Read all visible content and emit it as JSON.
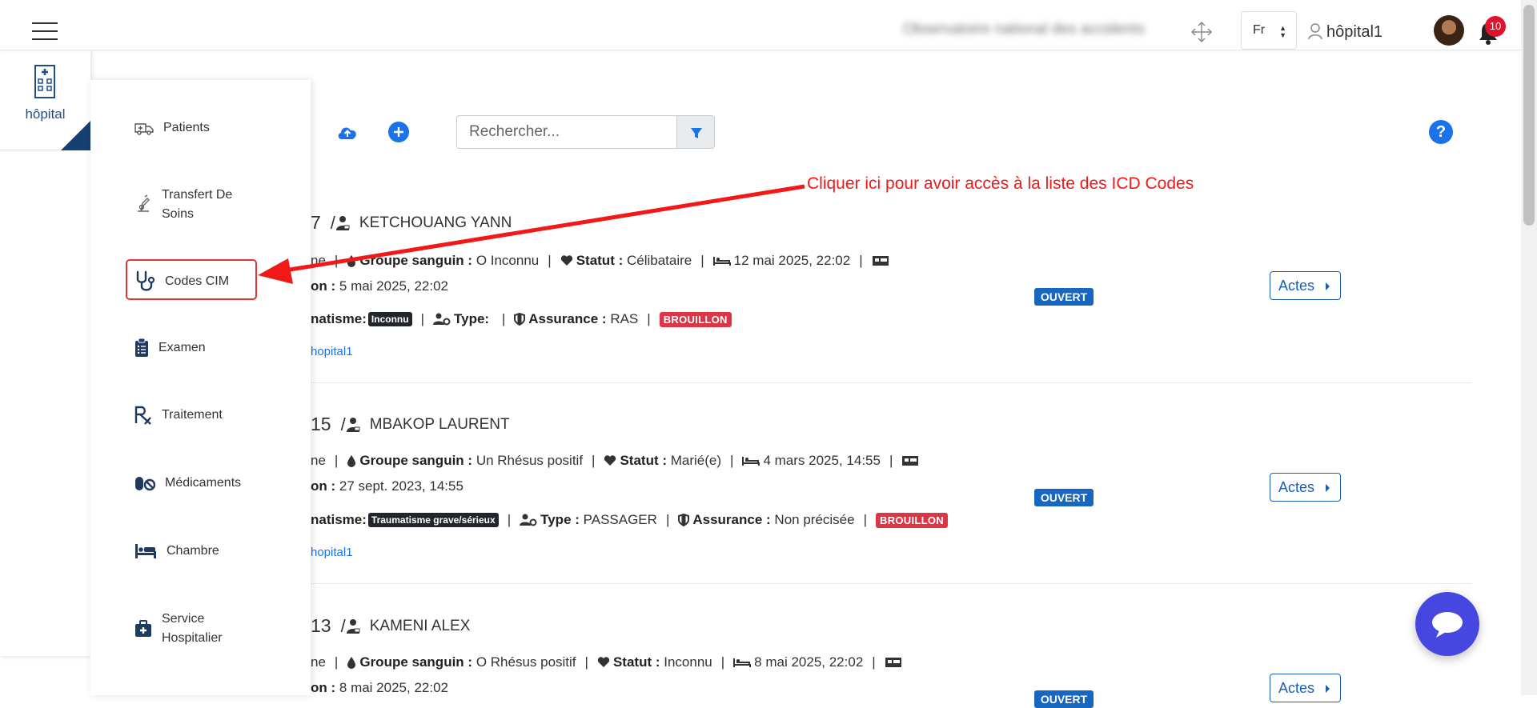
{
  "topbar": {
    "blurred_title": "Observatoire national des accidents",
    "language": "Fr",
    "username": "hôpital1",
    "notification_count": "10"
  },
  "left_panel": {
    "hospital_label": "hôpital"
  },
  "menu": {
    "items": [
      {
        "label": "Patients",
        "icon": "ambulance-icon"
      },
      {
        "label": "Transfert De Soins",
        "icon": "transfer-icon"
      },
      {
        "label": "Codes CIM",
        "icon": "stethoscope-icon"
      },
      {
        "label": "Examen",
        "icon": "clipboard-list-icon"
      },
      {
        "label": "Traitement",
        "icon": "prescription-icon"
      },
      {
        "label": "Médicaments",
        "icon": "pills-icon"
      },
      {
        "label": "Chambre",
        "icon": "bed-icon"
      },
      {
        "label": "Service Hospitalier",
        "icon": "medkit-icon"
      }
    ]
  },
  "toolbar": {
    "search_placeholder": "Rechercher..."
  },
  "annotation": {
    "text": "Cliquer ici pour avoir accès à la liste des ICD Codes",
    "color": "#f21818"
  },
  "patients": [
    {
      "id_fragment": "7",
      "name": "KETCHOUANG YANN",
      "gender_fragment": "ne",
      "blood_label": "Groupe sanguin :",
      "blood_value": "O Inconnu",
      "status_label": "Statut :",
      "status_value": "Célibataire",
      "admission_date": "12 mai 2025, 22:02",
      "date2_label_fragment": "on :",
      "date2": "5 mai 2025, 22:02",
      "trauma_label_fragment": "natisme:",
      "trauma_value": "Inconnu",
      "type_label": "Type:",
      "type_value": "",
      "insurance_label": "Assurance :",
      "insurance_value": "RAS",
      "draft_badge": "BROUILLON",
      "creator_fragment": "hopital1",
      "state": "OUVERT",
      "actions_label": "Actes"
    },
    {
      "id_fragment": "15",
      "name": "MBAKOP LAURENT",
      "gender_fragment": "ne",
      "blood_label": "Groupe sanguin :",
      "blood_value": "Un Rhésus positif",
      "status_label": "Statut :",
      "status_value": "Marié(e)",
      "admission_date": "4 mars 2025, 14:55",
      "date2_label_fragment": "on :",
      "date2": "27 sept. 2023, 14:55",
      "trauma_label_fragment": "natisme:",
      "trauma_value": "Traumatisme grave/sérieux",
      "type_label": "Type :",
      "type_value": "PASSAGER",
      "insurance_label": "Assurance :",
      "insurance_value": "Non précisée",
      "draft_badge": "BROUILLON",
      "creator_fragment": "hopital1",
      "state": "OUVERT",
      "actions_label": "Actes"
    },
    {
      "id_fragment": "13",
      "name": "KAMENI ALEX",
      "gender_fragment": "ne",
      "blood_label": "Groupe sanguin :",
      "blood_value": "O Rhésus positif",
      "status_label": "Statut :",
      "status_value": "Inconnu",
      "admission_date": "8 mai 2025, 22:02",
      "date2_label_fragment": "on :",
      "date2": "8 mai 2025, 22:02",
      "state": "OUVERT",
      "actions_label": "Actes"
    }
  ],
  "colors": {
    "primary_blue": "#1a73e8",
    "hospital_blue": "#1f4f8a",
    "open_badge": "#1766c2",
    "draft_badge": "#dc3545",
    "chat_button": "#4646e0"
  }
}
